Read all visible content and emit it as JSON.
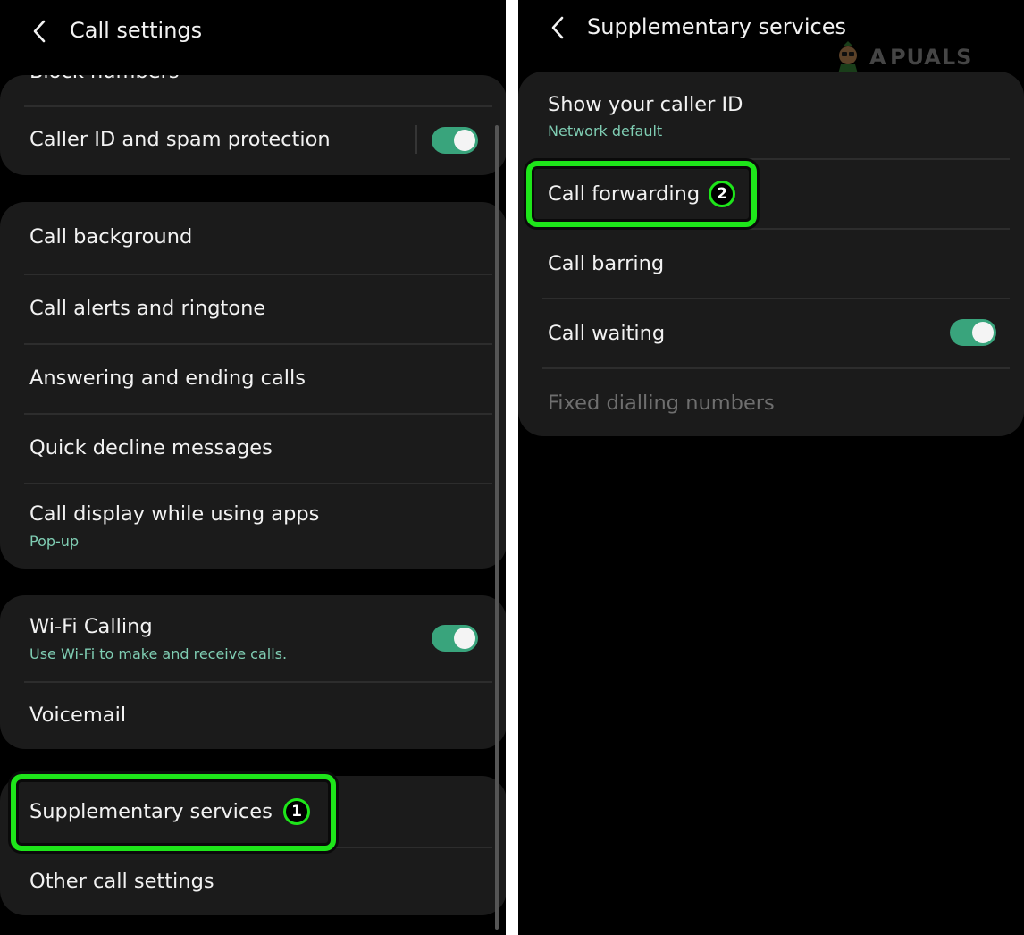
{
  "left_screen": {
    "header": {
      "title": "Call settings",
      "back_icon": "chevron-left-icon"
    },
    "partial_item": "Block numbers",
    "group1": [
      {
        "title": "Caller ID and spam protection",
        "toggle_on": true
      }
    ],
    "group2": [
      {
        "title": "Call background"
      },
      {
        "title": "Call alerts and ringtone"
      },
      {
        "title": "Answering and ending calls"
      },
      {
        "title": "Quick decline messages"
      },
      {
        "title": "Call display while using apps",
        "subtitle": "Pop-up"
      }
    ],
    "group3": [
      {
        "title": "Wi-Fi Calling",
        "subtitle": "Use Wi-Fi to make and receive calls.",
        "toggle_on": true
      },
      {
        "title": "Voicemail"
      }
    ],
    "group4": [
      {
        "title": "Supplementary services",
        "step": "1"
      },
      {
        "title": "Other call settings"
      }
    ]
  },
  "right_screen": {
    "header": {
      "title": "Supplementary services",
      "back_icon": "chevron-left-icon"
    },
    "items": [
      {
        "title": "Show your caller ID",
        "subtitle": "Network default"
      },
      {
        "title": "Call forwarding",
        "step": "2"
      },
      {
        "title": "Call barring"
      },
      {
        "title": "Call waiting",
        "toggle_on": true
      },
      {
        "title": "Fixed dialling numbers",
        "disabled": true
      }
    ]
  },
  "annotation": {
    "highlight_color": "#1ee51a"
  },
  "colors": {
    "background": "#000000",
    "card": "#1b1b1b",
    "toggle_on": "#39a47c",
    "subtitle": "#7fcdb3"
  }
}
